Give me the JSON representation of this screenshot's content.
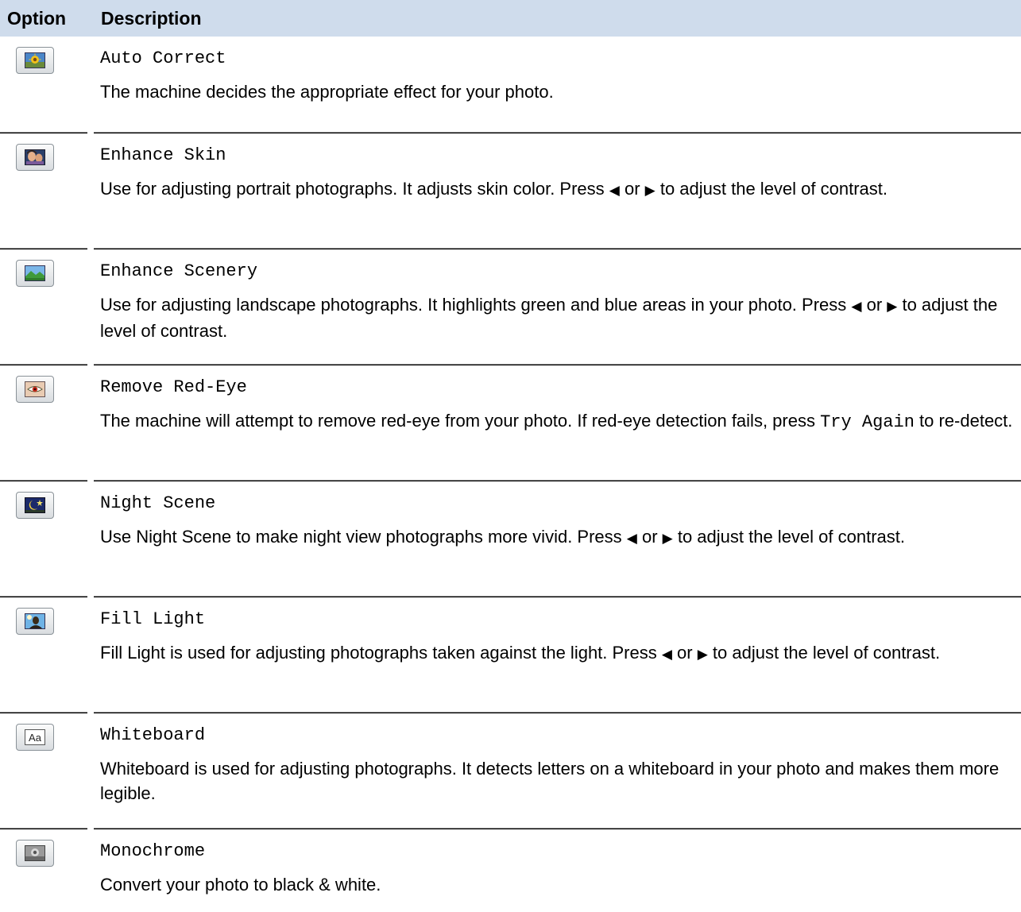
{
  "header": {
    "option": "Option",
    "description": "Description"
  },
  "rows": [
    {
      "icon": "auto-correct-icon",
      "name": "Auto Correct",
      "desc": "The machine decides the appropriate effect for your photo."
    },
    {
      "icon": "enhance-skin-icon",
      "name": "Enhance Skin",
      "desc_before": "Use for adjusting portrait photographs. It adjusts skin color. Press ",
      "left_arrow": "◀",
      "or": " or ",
      "right_arrow": "▶",
      "desc_after": " to adjust the level of contrast."
    },
    {
      "icon": "enhance-scenery-icon",
      "name": "Enhance Scenery",
      "desc_before": "Use for adjusting landscape photographs. It highlights green and blue areas in your photo. Press ",
      "left_arrow": "◀",
      "or": " or ",
      "right_arrow": "▶",
      "desc_after": " to adjust the level of contrast."
    },
    {
      "icon": "remove-red-eye-icon",
      "name": "Remove Red-Eye",
      "desc_before": "The machine will attempt to remove red-eye from your photo. If red-eye detection fails, press ",
      "button_text": "Try Again",
      "desc_after": " to re-detect."
    },
    {
      "icon": "night-scene-icon",
      "name": "Night Scene",
      "desc_before": "Use Night Scene to make night view photographs more vivid. Press ",
      "left_arrow": "◀",
      "or": " or ",
      "right_arrow": "▶",
      "desc_after": " to adjust the level of contrast."
    },
    {
      "icon": "fill-light-icon",
      "name": "Fill Light",
      "desc_before": "Fill Light is used for adjusting photographs taken against the light. Press ",
      "left_arrow": "◀",
      "or": " or ",
      "right_arrow": "▶",
      "desc_after": " to adjust the level of contrast."
    },
    {
      "icon": "whiteboard-icon",
      "icon_text": "Aa",
      "name": "Whiteboard",
      "desc": "Whiteboard is used for adjusting photographs. It detects letters on a whiteboard in your photo and makes them more legible."
    },
    {
      "icon": "monochrome-icon",
      "name": "Monochrome",
      "desc": "Convert your photo to black & white."
    }
  ],
  "colors": {
    "header_bg": "#cfdcec",
    "separator": "#000000"
  }
}
